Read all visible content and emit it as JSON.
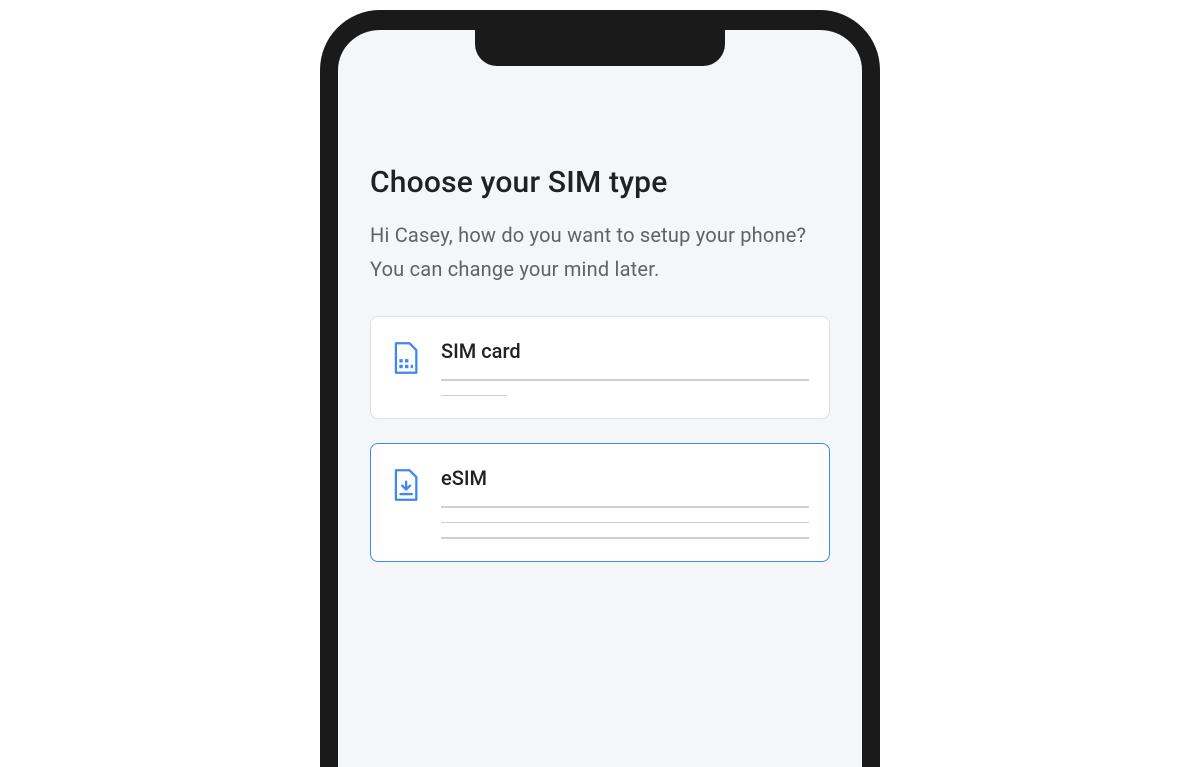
{
  "page": {
    "title": "Choose your SIM type",
    "subtitle": "Hi Casey, how do you want to setup your phone? You can change your mind later."
  },
  "options": [
    {
      "icon": "sim-card-icon",
      "label": "SIM card",
      "selected": false
    },
    {
      "icon": "esim-icon",
      "label": "eSIM",
      "selected": true
    }
  ],
  "colors": {
    "accent": "#4285f4",
    "text_primary": "#202124",
    "text_secondary": "#5f6368",
    "screen_bg": "#f5f6f7"
  }
}
